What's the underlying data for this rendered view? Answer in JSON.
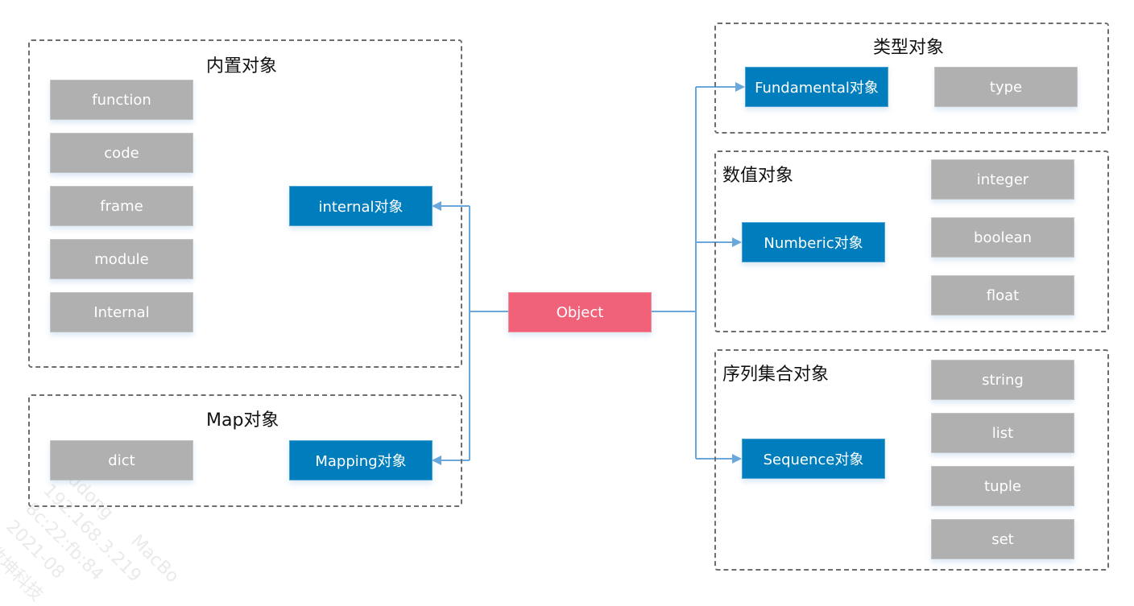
{
  "diagram": {
    "root": {
      "label": "Object",
      "color": "#f0617a"
    },
    "groups": {
      "builtin": {
        "title": "内置对象",
        "items": [
          "function",
          "code",
          "frame",
          "module",
          "Internal"
        ],
        "category": "internal对象"
      },
      "map": {
        "title": "Map对象",
        "items": [
          "dict"
        ],
        "category": "Mapping对象"
      },
      "type": {
        "title": "类型对象",
        "items": [
          "type"
        ],
        "category": "Fundamental对象"
      },
      "numeric": {
        "title": "数值对象",
        "items": [
          "integer",
          "boolean",
          "float"
        ],
        "category": "Numberic对象"
      },
      "sequence": {
        "title": "序列集合对象",
        "items": [
          "string",
          "list",
          "tuple",
          "set"
        ],
        "category": "Sequence对象"
      }
    },
    "colors": {
      "category": "#007dbd",
      "leaf": "#b0b0b0",
      "connector": "#6aa8dc",
      "group_border": "#6e6e6e"
    }
  },
  "watermark": {
    "lines": [
      "liudong",
      "192.168.3.219",
      "8c:22:fb:84",
      "2021-08",
      "数坤科技",
      "MacBo"
    ]
  }
}
